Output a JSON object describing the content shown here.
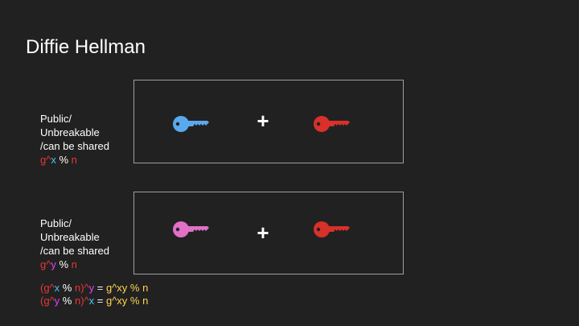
{
  "title": "Diffie Hellman",
  "panel1": {
    "label_lines": [
      "Public/",
      "Unbreakable",
      "/can be shared"
    ],
    "formula": [
      {
        "text": "g^",
        "color": "red"
      },
      {
        "text": "x",
        "color": "cyan"
      },
      {
        "text": " % ",
        "color": "white"
      },
      {
        "text": "n",
        "color": "red"
      }
    ],
    "left_key_color": "#5aa9ec",
    "right_key_color": "#d9302a",
    "plus": "+"
  },
  "panel2": {
    "label_lines": [
      "Public/",
      "Unbreakable",
      "/can be shared"
    ],
    "formula": [
      {
        "text": "g^",
        "color": "red"
      },
      {
        "text": "y",
        "color": "magenta"
      },
      {
        "text": " % ",
        "color": "white"
      },
      {
        "text": "n",
        "color": "red"
      }
    ],
    "left_key_color": "#e070c8",
    "right_key_color": "#d9302a",
    "plus": "+"
  },
  "equations": [
    [
      {
        "text": "(g^",
        "color": "red"
      },
      {
        "text": "x",
        "color": "cyan"
      },
      {
        "text": " % ",
        "color": "white"
      },
      {
        "text": "n)^",
        "color": "red"
      },
      {
        "text": "y",
        "color": "magenta"
      },
      {
        "text": " = ",
        "color": "white"
      },
      {
        "text": "g^xy % n",
        "color": "yellow"
      }
    ],
    [
      {
        "text": "(g^",
        "color": "red"
      },
      {
        "text": "y",
        "color": "magenta"
      },
      {
        "text": " % ",
        "color": "white"
      },
      {
        "text": "n)^",
        "color": "red"
      },
      {
        "text": "x",
        "color": "cyan"
      },
      {
        "text": " = ",
        "color": "white"
      },
      {
        "text": "g^xy % n",
        "color": "yellow"
      }
    ]
  ],
  "colors": {
    "background": "#212121",
    "box_border": "#9e9e9e",
    "red": "#e53935",
    "cyan": "#4fc3f7",
    "magenta": "#e040fb",
    "yellow": "#ffd54f",
    "white": "#ffffff"
  }
}
